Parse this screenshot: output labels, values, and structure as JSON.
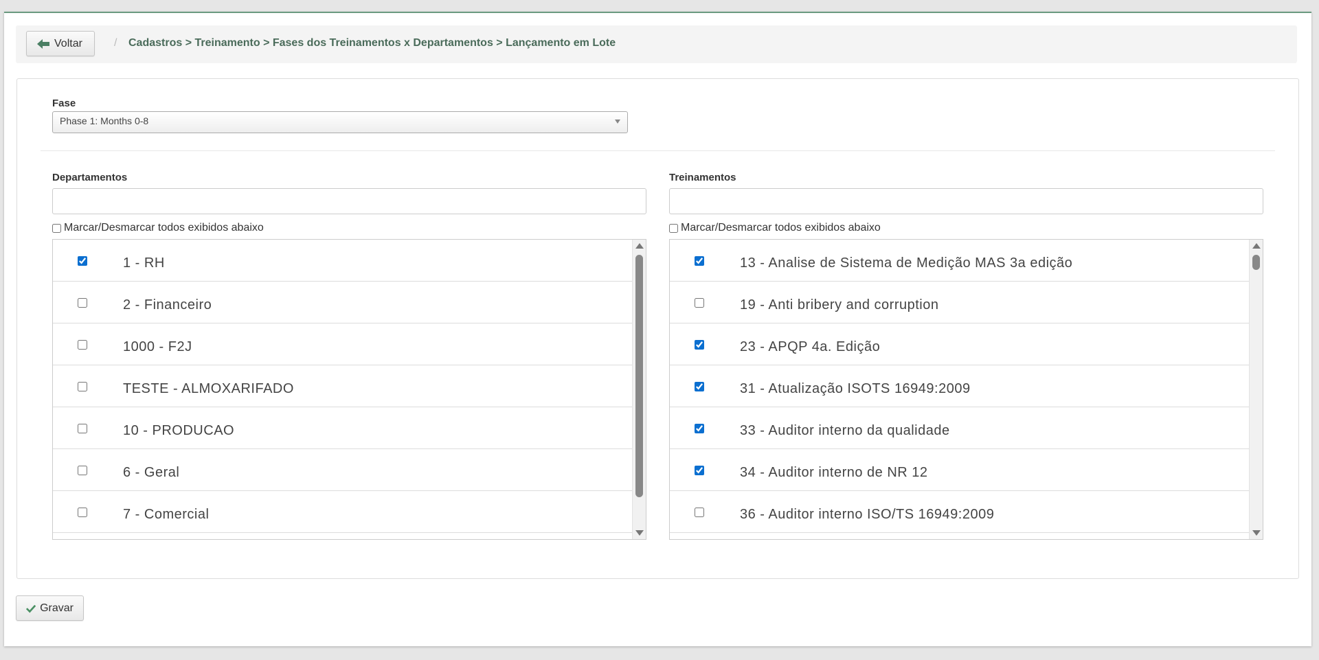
{
  "header": {
    "back_label": "Voltar",
    "separator": "/",
    "breadcrumb": "Cadastros > Treinamento > Fases dos Treinamentos x Departamentos > Lançamento em Lote"
  },
  "fase": {
    "label": "Fase",
    "selected": "Phase 1: Months 0-8"
  },
  "departamentos": {
    "label": "Departamentos",
    "filter_value": "",
    "toggle_all_label": "Marcar/Desmarcar todos exibidos abaixo",
    "items": [
      {
        "label": "1 - RH",
        "checked": true
      },
      {
        "label": "2 - Financeiro",
        "checked": false
      },
      {
        "label": "1000 - F2J",
        "checked": false
      },
      {
        "label": "TESTE - ALMOXARIFADO",
        "checked": false
      },
      {
        "label": "10 - PRODUCAO",
        "checked": false
      },
      {
        "label": "6 - Geral",
        "checked": false
      },
      {
        "label": "7 - Comercial",
        "checked": false
      }
    ]
  },
  "treinamentos": {
    "label": "Treinamentos",
    "filter_value": "",
    "toggle_all_label": "Marcar/Desmarcar todos exibidos abaixo",
    "items": [
      {
        "label": "13 - Analise de Sistema de Medição MAS 3a edição",
        "checked": true
      },
      {
        "label": "19 - Anti bribery and corruption",
        "checked": false
      },
      {
        "label": "23 - APQP 4a. Edição",
        "checked": true
      },
      {
        "label": "31 - Atualização ISOTS 16949:2009",
        "checked": true
      },
      {
        "label": "33 - Auditor interno da qualidade",
        "checked": true
      },
      {
        "label": "34 - Auditor interno de NR 12",
        "checked": true
      },
      {
        "label": "36 - Auditor interno ISO/TS 16949:2009",
        "checked": false
      }
    ]
  },
  "footer": {
    "save_label": "Gravar"
  },
  "icons": {
    "back": "arrow-left-icon",
    "save": "check-icon"
  },
  "colors": {
    "breadcrumb_text": "#4a6b5a",
    "accent_green": "#6b9a80",
    "checkbox_blue": "#0b6fd0"
  }
}
